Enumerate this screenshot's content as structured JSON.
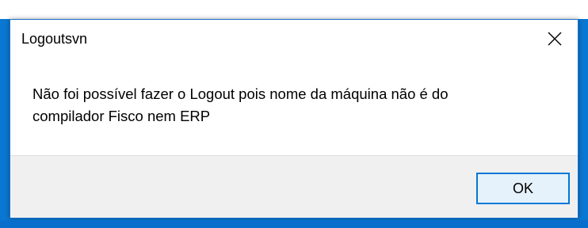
{
  "window": {
    "title": "Logoutsvn"
  },
  "dialog": {
    "message_line1": "Não foi possível fazer o Logout pois nome da máquina não é do",
    "message_line2": "compilador Fisco nem ERP",
    "ok_label": "OK"
  },
  "icons": {
    "close": "close-icon"
  },
  "colors": {
    "desktop_background": "#0a78d2",
    "dialog_background": "#ffffff",
    "footer_background": "#f0f0f0",
    "button_border_focus": "#0078d7",
    "button_background": "#e5f1fb"
  }
}
